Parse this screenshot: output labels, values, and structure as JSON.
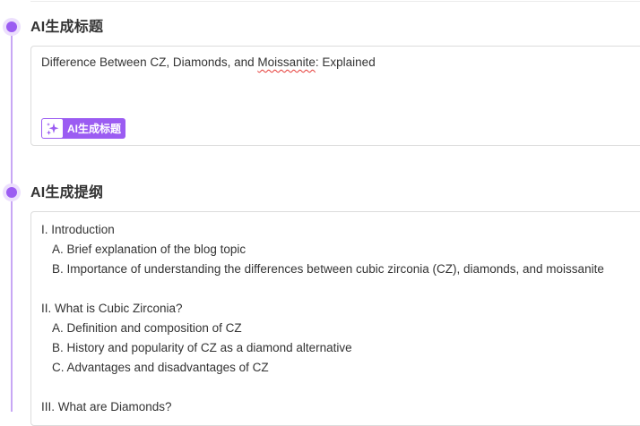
{
  "sections": {
    "title": {
      "heading": "AI生成标题",
      "title_before": "Difference Between CZ, Diamonds, and ",
      "title_misspelled": "Moissanite",
      "title_after": ": Explained",
      "generate_button_label": "AI生成标题",
      "generate_button_icon": "sparkle-icon"
    },
    "outline": {
      "heading": "AI生成提纲",
      "lines": [
        {
          "text": "I. Introduction",
          "level": 0
        },
        {
          "text": "A. Brief explanation of the blog topic",
          "level": 1
        },
        {
          "text": "B. Importance of understanding the differences between cubic zirconia (CZ), diamonds, and moissanite",
          "level": 1
        },
        {
          "text": "",
          "level": 0
        },
        {
          "text": "II. What is Cubic Zirconia?",
          "level": 0
        },
        {
          "text": "A. Definition and composition of CZ",
          "level": 1
        },
        {
          "text": "B. History and popularity of CZ as a diamond alternative",
          "level": 1
        },
        {
          "text": "C. Advantages and disadvantages of CZ",
          "level": 1
        },
        {
          "text": "",
          "level": 0
        },
        {
          "text": "III. What are Diamonds?",
          "level": 0
        }
      ]
    }
  },
  "colors": {
    "accent": "#9b5cf2",
    "accent_light": "#ecdffd",
    "timeline": "#c8a7f5",
    "border": "#dcdcdc",
    "text": "#333333"
  }
}
